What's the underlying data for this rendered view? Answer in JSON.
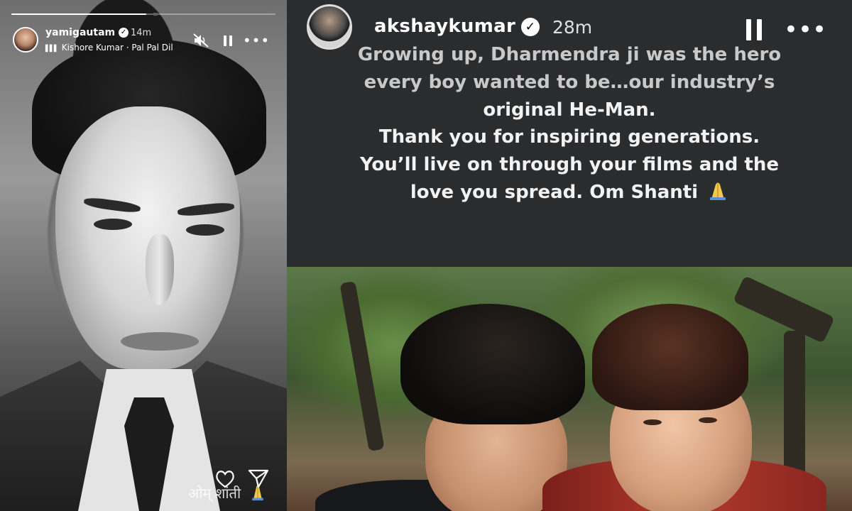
{
  "left_story": {
    "username": "yamigautam",
    "time": "14m",
    "music": {
      "artist": "Kishore Kumar",
      "separator": "·",
      "song": "Pal Pal Dil"
    },
    "progress": 0.51,
    "caption": "ओम् शांती",
    "icons": [
      "mute-icon",
      "pause-icon",
      "more-icon",
      "heart-icon",
      "send-icon",
      "prayer-emoji"
    ]
  },
  "right_story": {
    "username": "akshaykumar",
    "time": "28m",
    "quote_lines": [
      "Growing up, Dharmendra ji was the hero",
      "every boy wanted to be…our industry’s",
      "original He-Man.",
      "Thank you for inspiring generations.",
      "You’ll live on through your films and the",
      "love you spread. Om Shanti"
    ],
    "icons": [
      "pause-icon",
      "more-icon",
      "prayer-emoji"
    ]
  },
  "colors": {
    "background": "#000000",
    "right_text_bg": "#2b2c2e",
    "text": "#ffffff",
    "verified_badge": "#ffffff"
  }
}
